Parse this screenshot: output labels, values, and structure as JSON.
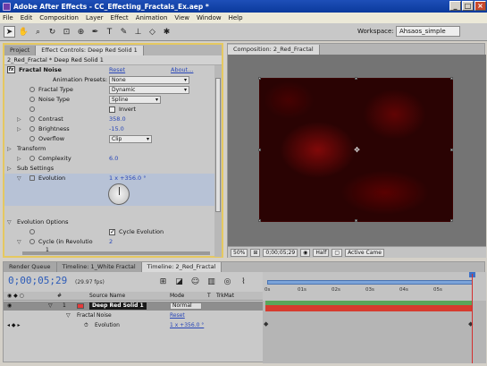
{
  "window": {
    "title": "Adobe After Effects - CC_Effecting_Fractals_Ex.aep *"
  },
  "menu": [
    "File",
    "Edit",
    "Composition",
    "Layer",
    "Effect",
    "Animation",
    "View",
    "Window",
    "Help"
  ],
  "toolbar": {
    "workspace_label": "Workspace:",
    "workspace_value": "Ahsaos_simple"
  },
  "left_panel": {
    "tabs": [
      "Project",
      "Effect Controls: Deep Red Solid 1"
    ],
    "subheader": "2_Red_Fractal * Deep Red Solid 1",
    "effect": {
      "name": "Fractal Noise",
      "reset": "Reset",
      "about": "About...",
      "presets_label": "Animation Presets:",
      "presets_value": "None"
    },
    "properties": {
      "fractal_type_label": "Fractal Type",
      "fractal_type_value": "Dynamic",
      "noise_type_label": "Noise Type",
      "noise_type_value": "Spline",
      "invert_label": "Invert",
      "contrast_label": "Contrast",
      "contrast_value": "358.0",
      "brightness_label": "Brightness",
      "brightness_value": "-15.0",
      "overflow_label": "Overflow",
      "overflow_value": "Clip",
      "transform_label": "Transform",
      "complexity_label": "Complexity",
      "complexity_value": "6.0",
      "sub_settings_label": "Sub Settings",
      "evolution_label": "Evolution",
      "evolution_value": "1 x +356.0 °",
      "evolution_options_label": "Evolution Options",
      "cycle_evolution_label": "Cycle Evolution",
      "cycle_revolution_label": "Cycle (in Revolutio",
      "cycle_revolution_value": "2",
      "slider_min": "1"
    }
  },
  "comp_panel": {
    "tab": "Composition: 2_Red_Fractal",
    "footer": {
      "zoom": "50%",
      "timecode": "0;00;05;29",
      "resolution": "Half",
      "camera": "Active Came"
    }
  },
  "timeline": {
    "tabs": [
      "Render Queue",
      "Timeline: 1_White Fractal",
      "Timeline: 2_Red_Fractal"
    ],
    "timecode": "0;00;05;29",
    "fps": "(29.97 fps)",
    "columns": {
      "source_name": "Source Name",
      "mode": "Mode",
      "t": "T",
      "trkmat": "TrkMat"
    },
    "layers": [
      {
        "number": "1",
        "name": "Deep Red Solid 1",
        "mode": "Normal"
      }
    ],
    "effect_row": {
      "name": "Fractal Noise",
      "reset": "Reset"
    },
    "evolution_row": {
      "name": "Evolution",
      "value": "1 x +356.0 °"
    },
    "ruler_ticks": [
      "0s",
      "01s",
      "02s",
      "03s",
      "04s",
      "05s"
    ]
  }
}
